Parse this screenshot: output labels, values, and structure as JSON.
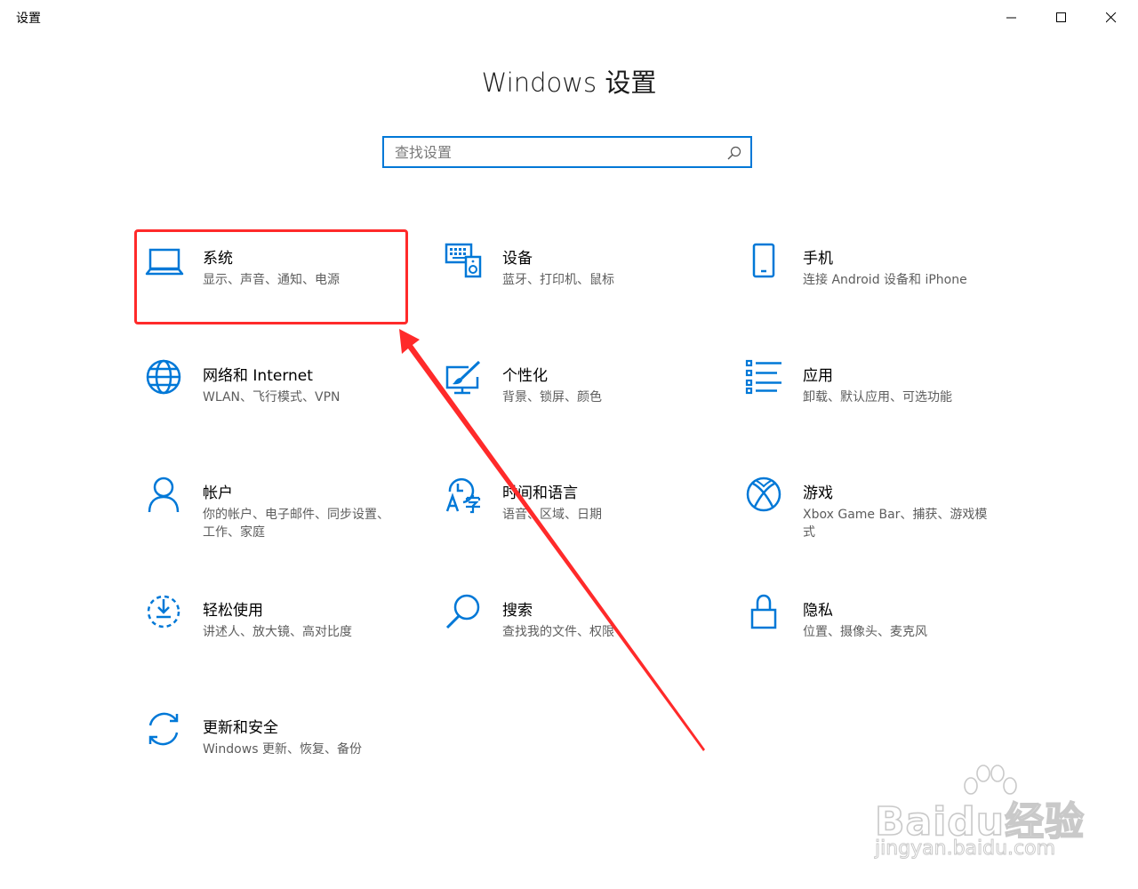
{
  "window": {
    "app_title": "设置"
  },
  "page": {
    "title": "Windows 设置"
  },
  "search": {
    "placeholder": "查找设置",
    "value": ""
  },
  "categories": [
    {
      "title": "系统",
      "desc": "显示、声音、通知、电源",
      "icon": "laptop-icon"
    },
    {
      "title": "设备",
      "desc": "蓝牙、打印机、鼠标",
      "icon": "devices-icon"
    },
    {
      "title": "手机",
      "desc": "连接 Android 设备和 iPhone",
      "icon": "phone-icon"
    },
    {
      "title": "网络和 Internet",
      "desc": "WLAN、飞行模式、VPN",
      "icon": "globe-icon"
    },
    {
      "title": "个性化",
      "desc": "背景、锁屏、颜色",
      "icon": "personalization-icon"
    },
    {
      "title": "应用",
      "desc": "卸载、默认应用、可选功能",
      "icon": "apps-list-icon"
    },
    {
      "title": "帐户",
      "desc": "你的帐户、电子邮件、同步设置、工作、家庭",
      "icon": "person-icon"
    },
    {
      "title": "时间和语言",
      "desc": "语音、区域、日期",
      "icon": "time-language-icon"
    },
    {
      "title": "游戏",
      "desc": "Xbox Game Bar、捕获、游戏模式",
      "icon": "xbox-icon"
    },
    {
      "title": "轻松使用",
      "desc": "讲述人、放大镜、高对比度",
      "icon": "ease-of-access-icon"
    },
    {
      "title": "搜索",
      "desc": "查找我的文件、权限",
      "icon": "search-magnifier-icon"
    },
    {
      "title": "隐私",
      "desc": "位置、摄像头、麦克风",
      "icon": "lock-icon"
    },
    {
      "title": "更新和安全",
      "desc": "Windows 更新、恢复、备份",
      "icon": "update-sync-icon"
    }
  ],
  "colors": {
    "accent": "#0078d7",
    "annotation": "#ff2a2a",
    "desc_text": "#5d5d5d"
  },
  "watermark": {
    "main": "Baidu经验",
    "sub": "jingyan.baidu.com"
  }
}
